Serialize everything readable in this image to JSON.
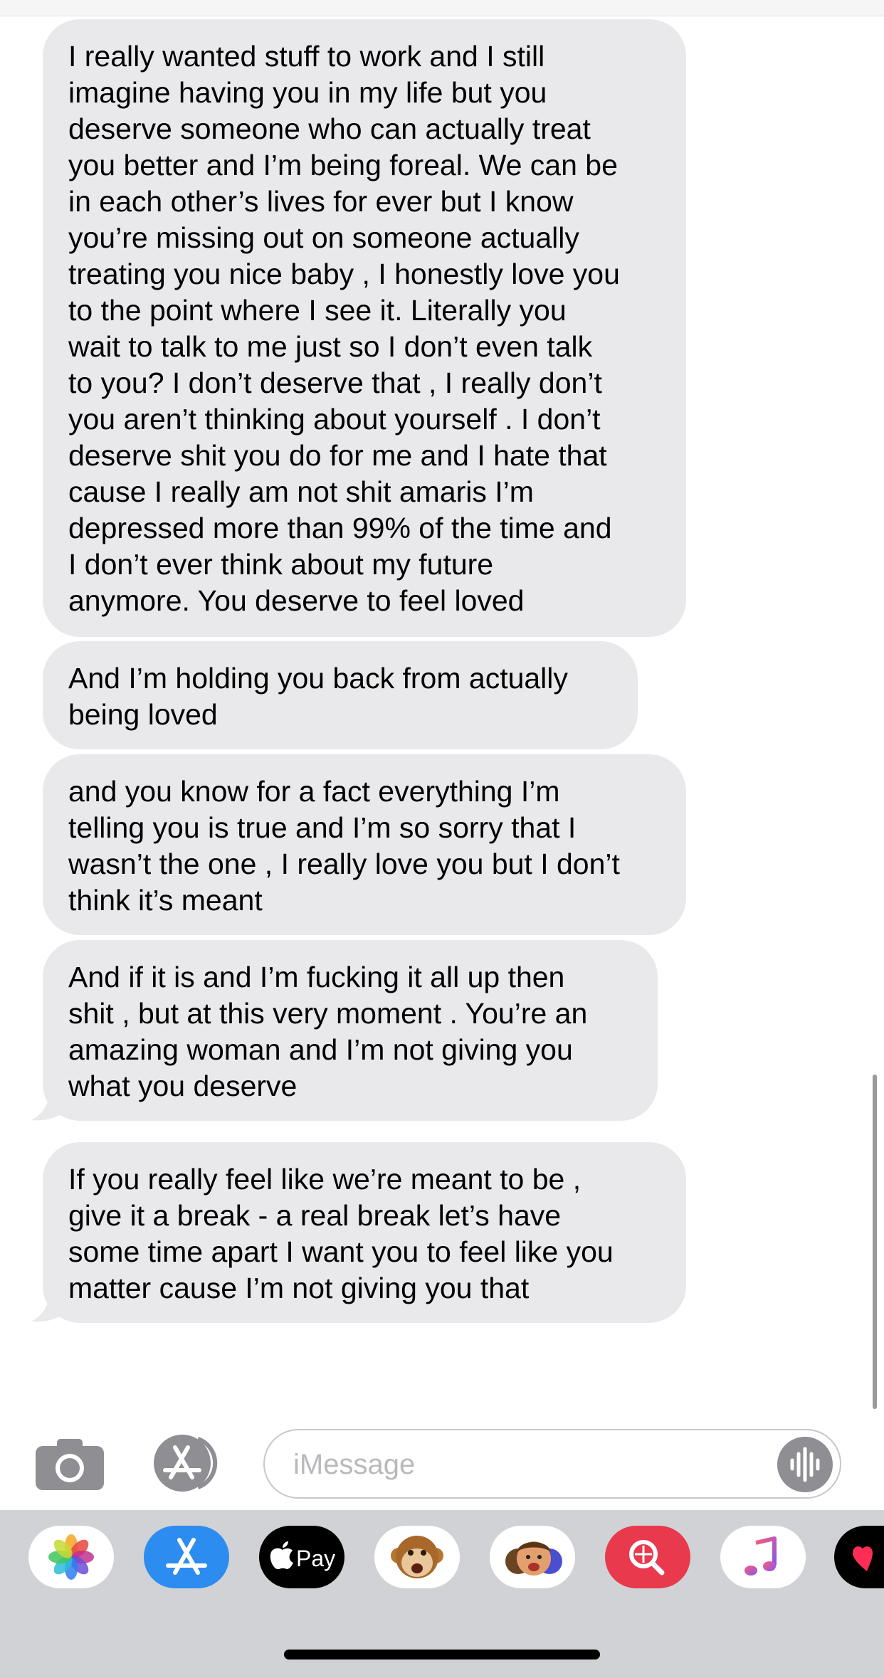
{
  "messages": [
    {
      "text": "I really wanted stuff to work and I still\nimagine having you in my life but you\ndeserve someone who can actually treat\nyou better and I’m being foreal. We can be\nin each other’s lives for ever but I know\nyou’re missing out on someone actually\ntreating you nice baby , I honestly love you\nto the point where I see it. Literally you\nwait to talk to me just so I don’t even talk\nto you? I don’t deserve that , I really don’t\nyou aren’t thinking about yourself . I don’t\ndeserve shit you do for me and I hate that\ncause I really am not shit amaris I’m\ndepressed more than 99% of the time and\nI don’t ever think about my future\nanymore.  You deserve to feel loved"
    },
    {
      "text": "And I’m holding you back from actually\nbeing loved"
    },
    {
      "text": "and you know for a fact everything I’m\ntelling you is true and I’m so sorry that I\nwasn’t the one , I really love you but I don’t\nthink it’s meant"
    },
    {
      "text": "And if it is and I’m fucking it all up then\nshit , but at this very moment . You’re an\namazing woman and I’m not giving you\nwhat you deserve"
    },
    {
      "text": "If you really feel like we’re meant to be ,\ngive it a break - a real break  let’s have\nsome time apart  I want you to feel like you\nmatter cause I’m not giving you that"
    }
  ],
  "compose": {
    "placeholder": "iMessage",
    "camera_icon": "camera-icon",
    "appstore_icon": "app-store-icon",
    "audio_icon": "audio-waveform-icon"
  },
  "app_drawer": {
    "apps": [
      {
        "name": "Photos",
        "icon": "photos-icon"
      },
      {
        "name": "App Store",
        "icon": "app-store-icon"
      },
      {
        "name": "Apple Pay",
        "icon": "apple-pay-icon",
        "label": "Pay"
      },
      {
        "name": "Animoji",
        "icon": "monkey-animoji-icon"
      },
      {
        "name": "Memoji Stickers",
        "icon": "memoji-icon"
      },
      {
        "name": "Images Search",
        "icon": "image-search-icon"
      },
      {
        "name": "Music",
        "icon": "music-note-icon"
      },
      {
        "name": "Digital Touch",
        "icon": "digital-touch-icon"
      }
    ]
  },
  "colors": {
    "incoming_bubble": "#e9e9eb",
    "drawer_background": "#d1d2d6",
    "appstore_blue": "#2d8cf0",
    "image_search_red": "#e8394d"
  }
}
